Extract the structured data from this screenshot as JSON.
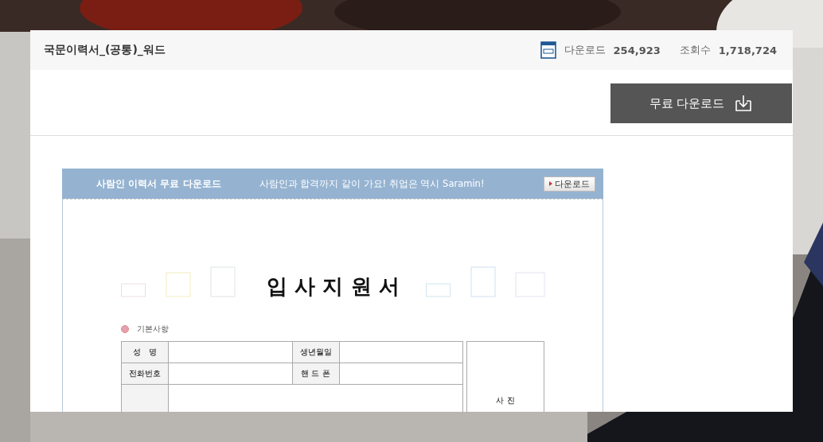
{
  "header": {
    "title": "국문이력서_(공통)_워드",
    "download_label": "다운로드",
    "download_count": "254,923",
    "views_label": "조회수",
    "views_count": "1,718,724"
  },
  "download_button": {
    "label": "무료 다운로드"
  },
  "preview": {
    "banner": {
      "title": "사람인 이력서 무료 다운로드",
      "slogan": "사람인과 합격까지 같이 가요! 취업은 역시 Saramin!",
      "button": "다운로드"
    },
    "document": {
      "title": "입 사 지 원 서",
      "section": "기본사항",
      "photo": "사 진",
      "rows": [
        [
          "성　명",
          "",
          "생년월일",
          ""
        ],
        [
          "전화번호",
          "",
          "핸 드 폰",
          ""
        ]
      ]
    }
  }
}
